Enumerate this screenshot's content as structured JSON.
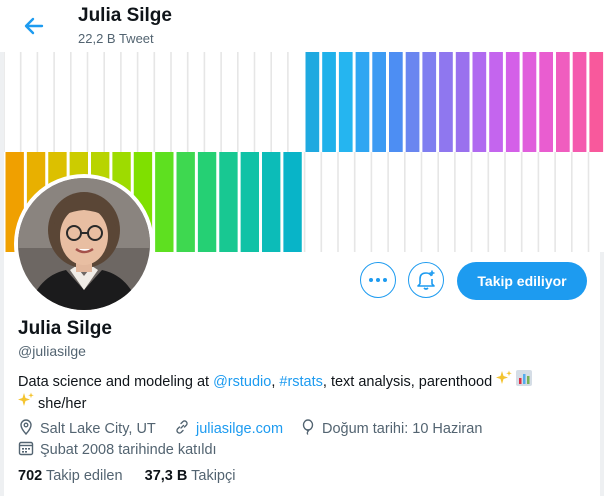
{
  "header": {
    "title": "Julia Silge",
    "tweet_count": "22,2 B Tweet"
  },
  "profile": {
    "name": "Julia Silge",
    "handle": "@juliasilge",
    "bio": {
      "text1": "Data science and modeling at ",
      "link1": "@rstudio",
      "text2": ", ",
      "link2": "#rstats",
      "text3": ", text analysis, parenthood ",
      "text4": " she/her"
    },
    "location": "Salt Lake City, UT",
    "website": "juliasilge.com",
    "birthday": "Doğum tarihi: 10 Haziran",
    "joined": "Şubat 2008 tarihinde katıldı"
  },
  "stats": {
    "following_count": "702",
    "following_label": "Takip edilen",
    "followers_count": "37,3 B",
    "followers_label": "Takipçi"
  },
  "actions": {
    "follow_label": "Takip ediliyor"
  },
  "colors": {
    "accent": "#1d9bf0"
  }
}
